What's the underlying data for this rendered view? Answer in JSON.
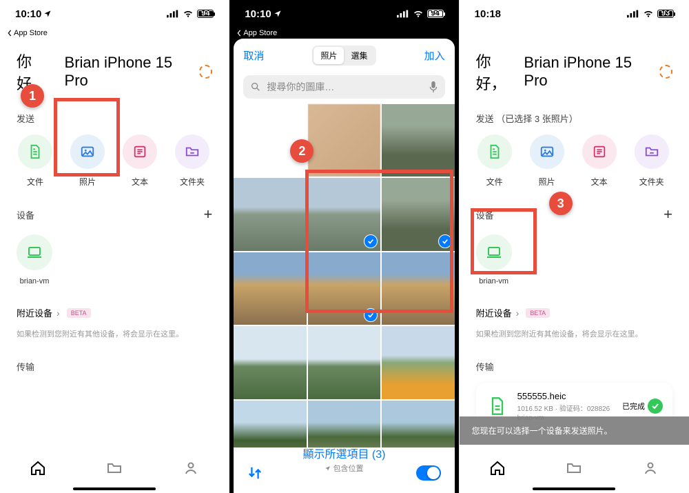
{
  "status": {
    "time1": "10:10",
    "time3": "10:18",
    "battery1": "94",
    "battery3": "93",
    "back_label": "App Store"
  },
  "greeting": {
    "prefix": "你好，",
    "name": "Brian iPhone 15 Pro"
  },
  "send": {
    "label1": "发送",
    "label3": "发送 （已选择 3 张照片）",
    "actions": [
      {
        "key": "files",
        "label": "文件",
        "bg": "#eaf7ec",
        "color": "#34c759"
      },
      {
        "key": "photos",
        "label": "照片",
        "bg": "#e6f0fb",
        "color": "#2f7bdc"
      },
      {
        "key": "text",
        "label": "文本",
        "bg": "#fbe8ee",
        "color": "#d6336c"
      },
      {
        "key": "folder",
        "label": "文件夹",
        "bg": "#f3ecfa",
        "color": "#8a4bd6"
      }
    ]
  },
  "devices": {
    "label": "设备",
    "item": "brian-vm"
  },
  "nearby": {
    "label": "附近设备",
    "beta": "BETA",
    "desc": "如果检测到您附近有其他设备，将会显示在这里。"
  },
  "transfer": {
    "label": "传输",
    "file": {
      "name": "555555.heic",
      "size": "1016.52 KB",
      "code_label": "验证码：",
      "code": "028826",
      "from": "brian-vm",
      "done": "已完成"
    }
  },
  "banner": "您现在可以选择一个设备来发送照片。",
  "picker": {
    "cancel": "取消",
    "add": "加入",
    "tab_photos": "照片",
    "tab_albums": "選集",
    "search_placeholder": "搜尋你的圖庫…",
    "selected_label": "顯示所選項目 (3)",
    "location": "包含位置"
  },
  "badges": {
    "b1": "1",
    "b2": "2",
    "b3": "3"
  }
}
